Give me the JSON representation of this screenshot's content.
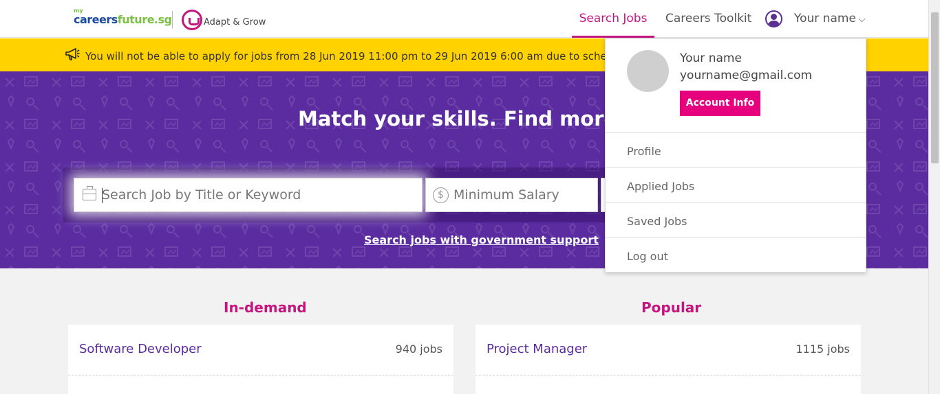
{
  "header": {
    "logo_my": "my",
    "logo_careers": "careers",
    "logo_future": "future.sg",
    "logo2_text": "Adapt & Grow",
    "nav": {
      "search_jobs": "Search Jobs",
      "careers_toolkit": "Careers Toolkit",
      "user_name": "Your name"
    }
  },
  "notice": {
    "text": "You will not be able to apply for jobs from 28 Jun 2019 11:00 pm to 29 Jun 2019 6:00 am due to scheduled ma"
  },
  "hero": {
    "title": "Match your skills. Find more jol",
    "keyword_placeholder": "Search Job by Title or Keyword",
    "salary_placeholder": "Minimum Salary",
    "salary_icon_glyph": "$",
    "gov_link": "Search jobs with government support"
  },
  "lists": {
    "in_demand": {
      "title": "In-demand",
      "items": [
        {
          "title": "Software Developer",
          "count": "940 jobs"
        }
      ]
    },
    "popular": {
      "title": "Popular",
      "items": [
        {
          "title": "Project Manager",
          "count": "1115 jobs"
        }
      ]
    }
  },
  "dropdown": {
    "name": "Your name",
    "email": "yourname@gmail.com",
    "account_button": "Account Info",
    "items": [
      "Profile",
      "Applied Jobs",
      "Saved Jobs",
      "Log out"
    ]
  },
  "colors": {
    "brand_purple": "#5a2ca0",
    "brand_magenta": "#c4167f",
    "button_pink": "#e6007e",
    "notice_yellow": "#ffd200"
  }
}
